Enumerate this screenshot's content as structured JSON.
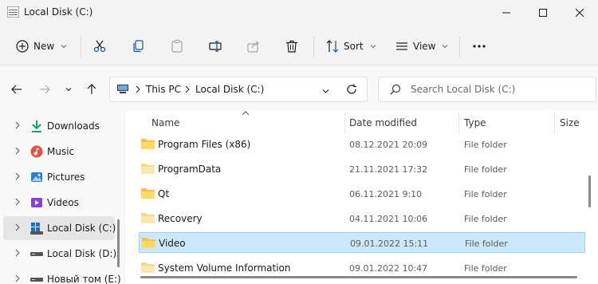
{
  "window": {
    "title": "Local Disk (C:)",
    "minimize_icon": "minimize-icon",
    "maximize_icon": "maximize-icon",
    "close_icon": "close-icon"
  },
  "toolbar": {
    "new_label": "New",
    "sort_label": "Sort",
    "view_label": "View",
    "icons": [
      "new-icon",
      "cut-icon",
      "copy-icon",
      "paste-icon",
      "rename-icon",
      "share-icon",
      "delete-icon",
      "sort-icon",
      "view-icon",
      "more-icon"
    ]
  },
  "address": {
    "crumbs": [
      "This PC",
      "Local Disk (C:)"
    ],
    "search_placeholder": "Search Local Disk (C:)"
  },
  "sidebar": {
    "items": [
      {
        "label": "Downloads",
        "icon": "download-icon",
        "color": "#1aa260"
      },
      {
        "label": "Music",
        "icon": "music-icon",
        "color": "#e2523c"
      },
      {
        "label": "Pictures",
        "icon": "pictures-icon",
        "color": "#2a7fd4"
      },
      {
        "label": "Videos",
        "icon": "videos-icon",
        "color": "#8a3fd1"
      },
      {
        "label": "Local Disk (C:)",
        "icon": "windows-drive-icon",
        "color": "#1a73c9"
      },
      {
        "label": "Local Disk (D:)",
        "icon": "drive-icon",
        "color": "#555555"
      },
      {
        "label": "Новый том (E:)",
        "icon": "drive-icon",
        "color": "#555555"
      }
    ]
  },
  "columns": {
    "name": "Name",
    "date": "Date modified",
    "type": "Type",
    "size": "Size"
  },
  "files": [
    {
      "name": "Program Files (x86)",
      "date": "08.12.2021 20:09",
      "type": "File folder"
    },
    {
      "name": "ProgramData",
      "date": "21.11.2021 17:32",
      "type": "File folder"
    },
    {
      "name": "Qt",
      "date": "06.11.2021 9:10",
      "type": "File folder"
    },
    {
      "name": "Recovery",
      "date": "04.11.2021 10:06",
      "type": "File folder"
    },
    {
      "name": "Video",
      "date": "09.01.2022 15:11",
      "type": "File folder",
      "selected": true
    },
    {
      "name": "System Volume Information",
      "date": "09.01.2022 10:47",
      "type": "File folder"
    }
  ],
  "colors": {
    "folder": "#f2c14e",
    "folder_pale": "#f5d98a",
    "selection_bg": "#cce8ff",
    "selection_border": "#99d1ff",
    "accent": "#0067c0"
  }
}
